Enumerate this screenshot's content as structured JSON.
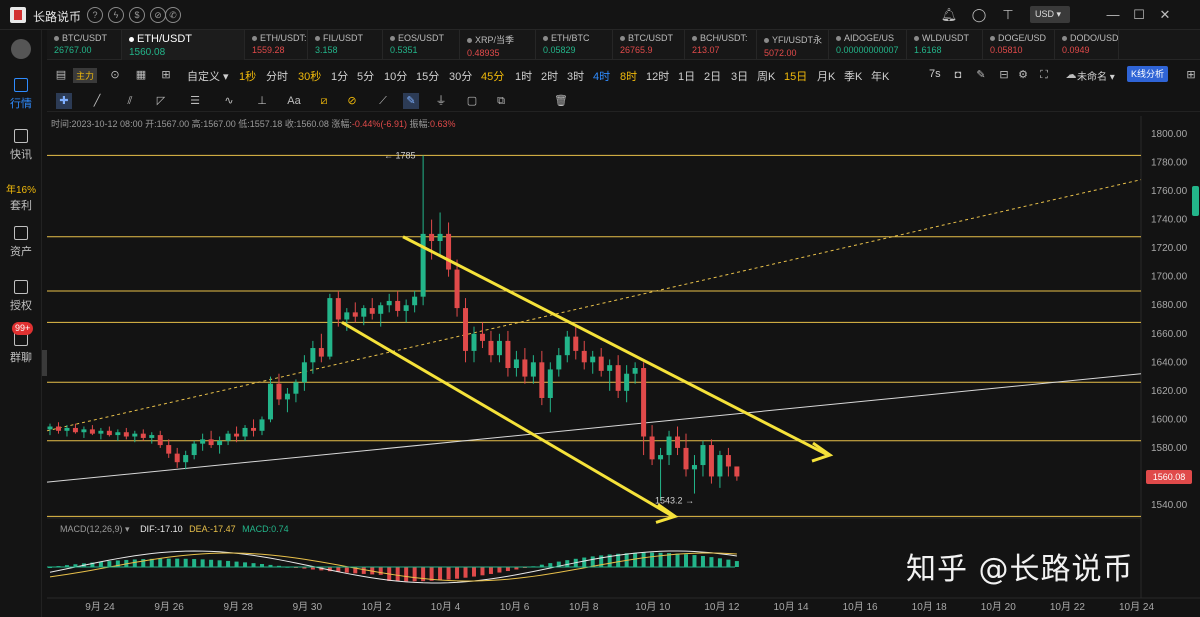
{
  "app": {
    "title": "长路说币",
    "currency": "USD",
    "watermark": "知乎 @长路说币"
  },
  "sidebar": {
    "items": [
      {
        "label": "行情",
        "active": true
      },
      {
        "label": "快讯",
        "active": false
      },
      {
        "label": "套利",
        "active": false
      },
      {
        "label": "资产",
        "active": false
      },
      {
        "label": "授权",
        "active": false
      },
      {
        "label": "群聊",
        "active": false
      }
    ],
    "annual_label": "年16%",
    "badge": "99+"
  },
  "tickers": [
    {
      "pair": "BTC/USDT",
      "price": "26767.00",
      "color": "#23b58a",
      "active": false
    },
    {
      "pair": "ETH/USDT",
      "price": "1560.08",
      "color": "#23b58a",
      "active": true
    },
    {
      "pair": "ETH/USDT:",
      "price": "1559.28",
      "color": "#e04a4a",
      "active": false
    },
    {
      "pair": "FIL/USDT",
      "price": "3.158",
      "color": "#23b58a",
      "active": false
    },
    {
      "pair": "EOS/USDT",
      "price": "0.5351",
      "color": "#23b58a",
      "active": false
    },
    {
      "pair": "XRP/当季",
      "price": "0.48935",
      "color": "#e04a4a",
      "active": false
    },
    {
      "pair": "ETH/BTC",
      "price": "0.05829",
      "color": "#23b58a",
      "active": false
    },
    {
      "pair": "BTC/USDT",
      "price": "26765.9",
      "color": "#e04a4a",
      "active": false
    },
    {
      "pair": "BCH/USDT:",
      "price": "213.07",
      "color": "#e04a4a",
      "active": false
    },
    {
      "pair": "YFI/USDT永",
      "price": "5072.00",
      "color": "#e04a4a",
      "active": false
    },
    {
      "pair": "AIDOGE/US",
      "price": "0.00000000007",
      "color": "#23b58a",
      "active": false
    },
    {
      "pair": "WLD/USDT",
      "price": "1.6168",
      "color": "#23b58a",
      "active": false
    },
    {
      "pair": "DOGE/USD",
      "price": "0.05810",
      "color": "#e04a4a",
      "active": false
    },
    {
      "pair": "DODO/USD",
      "price": "0.0949",
      "color": "#e04a4a",
      "active": false
    }
  ],
  "toolbar": {
    "main_indicator": "主力",
    "custom": "自定义",
    "intervals": [
      "1秒",
      "分时",
      "30秒",
      "1分",
      "5分",
      "10分",
      "15分",
      "30分",
      "45分",
      "1时",
      "2时",
      "3时",
      "4时",
      "8时",
      "12时",
      "1日",
      "2日",
      "3日",
      "周K",
      "15日",
      "月K",
      "季K",
      "年K"
    ],
    "highlighted_intervals": [
      "1秒",
      "30秒",
      "45分",
      "8时",
      "15日"
    ],
    "selected_interval": "4时",
    "countdown": "7s",
    "layout_name": "未命名",
    "k_analysis": "K线分析",
    "drawing_tools": [
      "crosshair-icon",
      "trendline-icon",
      "parallel-icon",
      "ray-icon",
      "horizontal-lines-icon",
      "wave-icon",
      "fib-icon",
      "text-icon",
      "magnet-icon",
      "lock-drawing-icon",
      "ruler-icon",
      "brush-icon",
      "shapes-icon",
      "copy-icon",
      "clone-icon",
      "trash-icon"
    ]
  },
  "info_bar": {
    "time_label": "时间:",
    "time": "2023-10-12 08:00",
    "open_label": "开:",
    "open": "1567.00",
    "high_label": "高:",
    "high": "1567.00",
    "low_label": "低:",
    "low": "1557.18",
    "close_label": "收:",
    "close": "1560.08",
    "change_label": "涨幅:",
    "change": "-0.44%(-6.91)",
    "amplitude_label": "振幅:",
    "amplitude": "0.63%"
  },
  "macd": {
    "label": "MACD(12,26,9)",
    "dif_label": "DIF:",
    "dif": "-17.10",
    "dea_label": "DEA:",
    "dea": "-17.47",
    "macd_label": "MACD:",
    "macd": "0.74"
  },
  "chart_data": {
    "type": "candlestick",
    "pair": "ETH/USDT",
    "interval": "4h",
    "current_price": "1560.08",
    "y_ticks": [
      1800,
      1780,
      1760,
      1740,
      1720,
      1700,
      1680,
      1660,
      1640,
      1620,
      1600,
      1580,
      1560,
      1540
    ],
    "ylim": [
      1530,
      1806
    ],
    "x_ticks": [
      "9月 24",
      "9月 26",
      "9月 28",
      "9月 30",
      "10月 2",
      "10月 4",
      "10月 6",
      "10月 8",
      "10月 10",
      "10月 12",
      "10月 14",
      "10月 16",
      "10月 18",
      "10月 20",
      "10月 22",
      "10月 24"
    ],
    "annotations": [
      {
        "text": "1785",
        "price": 1785
      },
      {
        "text": "1543.2",
        "price": 1543.2
      }
    ],
    "horizontal_levels": [
      1785,
      1728,
      1690,
      1668,
      1626,
      1585,
      1532
    ],
    "colors": {
      "up": "#23b58a",
      "down": "#e04a4a",
      "levels": "#e8c04a",
      "arrows": "#f5e23a"
    },
    "candles": [
      [
        1593,
        1597,
        1589,
        1595
      ],
      [
        1595,
        1598,
        1590,
        1592
      ],
      [
        1592,
        1596,
        1588,
        1594
      ],
      [
        1594,
        1597,
        1590,
        1591
      ],
      [
        1591,
        1595,
        1587,
        1593
      ],
      [
        1593,
        1596,
        1589,
        1590
      ],
      [
        1590,
        1594,
        1586,
        1592
      ],
      [
        1592,
        1595,
        1588,
        1589
      ],
      [
        1589,
        1593,
        1585,
        1591
      ],
      [
        1591,
        1594,
        1586,
        1588
      ],
      [
        1588,
        1592,
        1584,
        1590
      ],
      [
        1590,
        1593,
        1585,
        1587
      ],
      [
        1587,
        1591,
        1583,
        1589
      ],
      [
        1589,
        1592,
        1580,
        1582
      ],
      [
        1582,
        1586,
        1573,
        1576
      ],
      [
        1576,
        1580,
        1566,
        1570
      ],
      [
        1570,
        1578,
        1565,
        1575
      ],
      [
        1575,
        1585,
        1572,
        1583
      ],
      [
        1583,
        1590,
        1578,
        1586
      ],
      [
        1586,
        1592,
        1580,
        1582
      ],
      [
        1582,
        1588,
        1576,
        1585
      ],
      [
        1585,
        1592,
        1582,
        1590
      ],
      [
        1590,
        1595,
        1584,
        1588
      ],
      [
        1588,
        1596,
        1585,
        1594
      ],
      [
        1594,
        1600,
        1588,
        1592
      ],
      [
        1592,
        1602,
        1589,
        1600
      ],
      [
        1600,
        1630,
        1598,
        1625
      ],
      [
        1625,
        1632,
        1610,
        1614
      ],
      [
        1614,
        1622,
        1605,
        1618
      ],
      [
        1618,
        1628,
        1612,
        1626
      ],
      [
        1626,
        1645,
        1620,
        1640
      ],
      [
        1640,
        1655,
        1632,
        1650
      ],
      [
        1650,
        1660,
        1640,
        1644
      ],
      [
        1644,
        1688,
        1642,
        1685
      ],
      [
        1685,
        1690,
        1665,
        1670
      ],
      [
        1670,
        1678,
        1662,
        1675
      ],
      [
        1675,
        1682,
        1668,
        1672
      ],
      [
        1672,
        1680,
        1666,
        1678
      ],
      [
        1678,
        1685,
        1670,
        1674
      ],
      [
        1674,
        1682,
        1665,
        1680
      ],
      [
        1680,
        1688,
        1675,
        1683
      ],
      [
        1683,
        1690,
        1672,
        1676
      ],
      [
        1676,
        1684,
        1668,
        1680
      ],
      [
        1680,
        1690,
        1675,
        1686
      ],
      [
        1686,
        1785,
        1680,
        1730
      ],
      [
        1730,
        1740,
        1712,
        1725
      ],
      [
        1725,
        1745,
        1715,
        1730
      ],
      [
        1730,
        1738,
        1700,
        1705
      ],
      [
        1705,
        1712,
        1672,
        1678
      ],
      [
        1678,
        1685,
        1640,
        1648
      ],
      [
        1648,
        1665,
        1640,
        1660
      ],
      [
        1660,
        1668,
        1650,
        1655
      ],
      [
        1655,
        1662,
        1640,
        1645
      ],
      [
        1645,
        1660,
        1640,
        1655
      ],
      [
        1655,
        1662,
        1630,
        1636
      ],
      [
        1636,
        1648,
        1630,
        1642
      ],
      [
        1642,
        1650,
        1625,
        1630
      ],
      [
        1630,
        1645,
        1625,
        1640
      ],
      [
        1640,
        1648,
        1610,
        1615
      ],
      [
        1615,
        1640,
        1605,
        1635
      ],
      [
        1635,
        1650,
        1630,
        1645
      ],
      [
        1645,
        1662,
        1640,
        1658
      ],
      [
        1658,
        1665,
        1642,
        1648
      ],
      [
        1648,
        1655,
        1635,
        1640
      ],
      [
        1640,
        1648,
        1632,
        1644
      ],
      [
        1644,
        1650,
        1630,
        1634
      ],
      [
        1634,
        1642,
        1620,
        1638
      ],
      [
        1638,
        1645,
        1615,
        1620
      ],
      [
        1620,
        1638,
        1612,
        1632
      ],
      [
        1632,
        1640,
        1625,
        1636
      ],
      [
        1636,
        1640,
        1575,
        1588
      ],
      [
        1588,
        1596,
        1568,
        1572
      ],
      [
        1572,
        1580,
        1543,
        1575
      ],
      [
        1575,
        1592,
        1568,
        1588
      ],
      [
        1588,
        1595,
        1575,
        1580
      ],
      [
        1580,
        1590,
        1560,
        1565
      ],
      [
        1565,
        1575,
        1548,
        1568
      ],
      [
        1568,
        1585,
        1560,
        1582
      ],
      [
        1582,
        1586,
        1555,
        1560
      ],
      [
        1560,
        1578,
        1552,
        1575
      ],
      [
        1575,
        1580,
        1560,
        1567
      ],
      [
        1567,
        1567,
        1557,
        1560
      ]
    ]
  }
}
